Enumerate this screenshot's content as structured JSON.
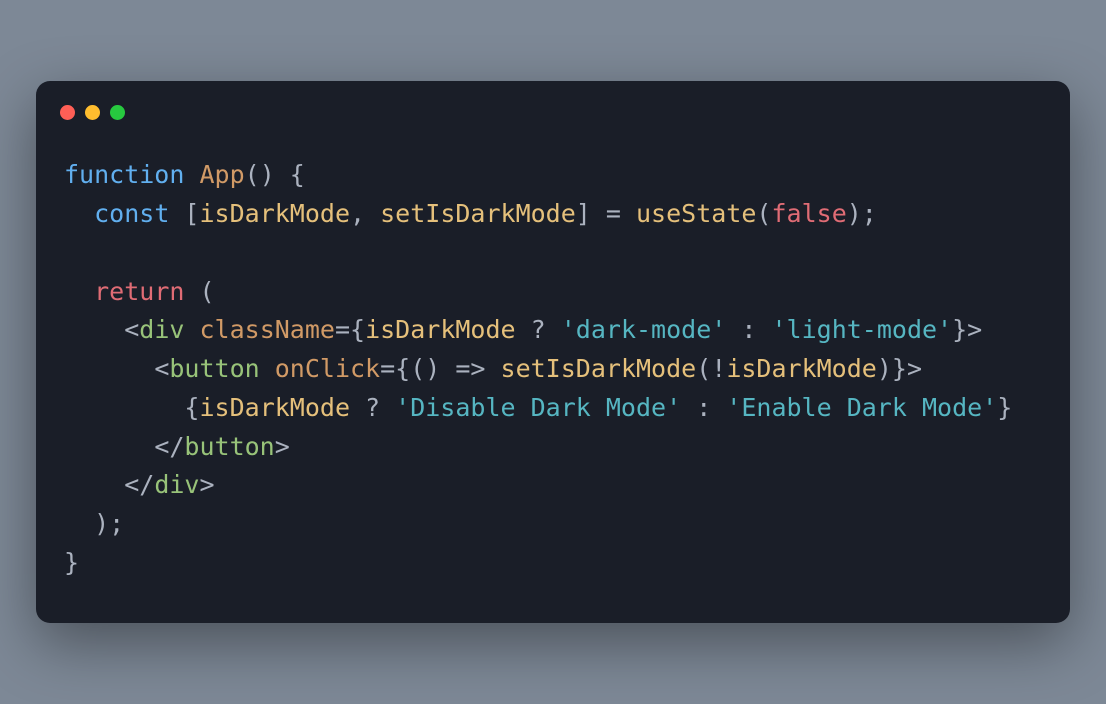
{
  "code": {
    "t1_function": "function",
    "t2_App": "App",
    "t3_parens_brace": "() {",
    "t4_const": "const",
    "t5_openBracket": " [",
    "t6_isDarkMode": "isDarkMode",
    "t7_comma": ", ",
    "t8_setIsDarkMode": "setIsDarkMode",
    "t9_closeBracket": "] ",
    "t10_equals": "= ",
    "t11_useState": "useState",
    "t12_openParen": "(",
    "t13_false": "false",
    "t14_closeParenSemi": ");",
    "t15_return": "return",
    "t16_openParen2": " (",
    "t17_lt": "<",
    "t18_div": "div",
    "t19_space": " ",
    "t20_className": "className",
    "t21_eqBrace": "={",
    "t22_isDarkMode2": "isDarkMode",
    "t23_tern1": " ? ",
    "t24_darkmode": "'dark-mode'",
    "t25_tern2": " : ",
    "t26_lightmode": "'light-mode'",
    "t27_braceGt": "}>",
    "t28_lt2": "<",
    "t29_button": "button",
    "t30_space2": " ",
    "t31_onClick": "onClick",
    "t32_eqBrace2": "={",
    "t33_arrowFn": "() => ",
    "t34_setIsDarkMode2": "setIsDarkMode",
    "t35_openParen3": "(",
    "t36_bang": "!",
    "t37_isDarkMode3": "isDarkMode",
    "t38_closeParen3": ")",
    "t39_braceGt2": "}>",
    "t40_braceOpen": "{",
    "t41_isDarkMode4": "isDarkMode",
    "t42_tern3": " ? ",
    "t43_disable": "'Disable Dark Mode'",
    "t44_tern4": " : ",
    "t45_enable": "'Enable Dark Mode'",
    "t46_braceClose": "}",
    "t47_ltSlash": "</",
    "t48_button2": "button",
    "t49_gt": ">",
    "t50_ltSlash2": "</",
    "t51_div2": "div",
    "t52_gt2": ">",
    "t53_closeParenSemi2": ");",
    "t54_closeBrace": "}"
  }
}
